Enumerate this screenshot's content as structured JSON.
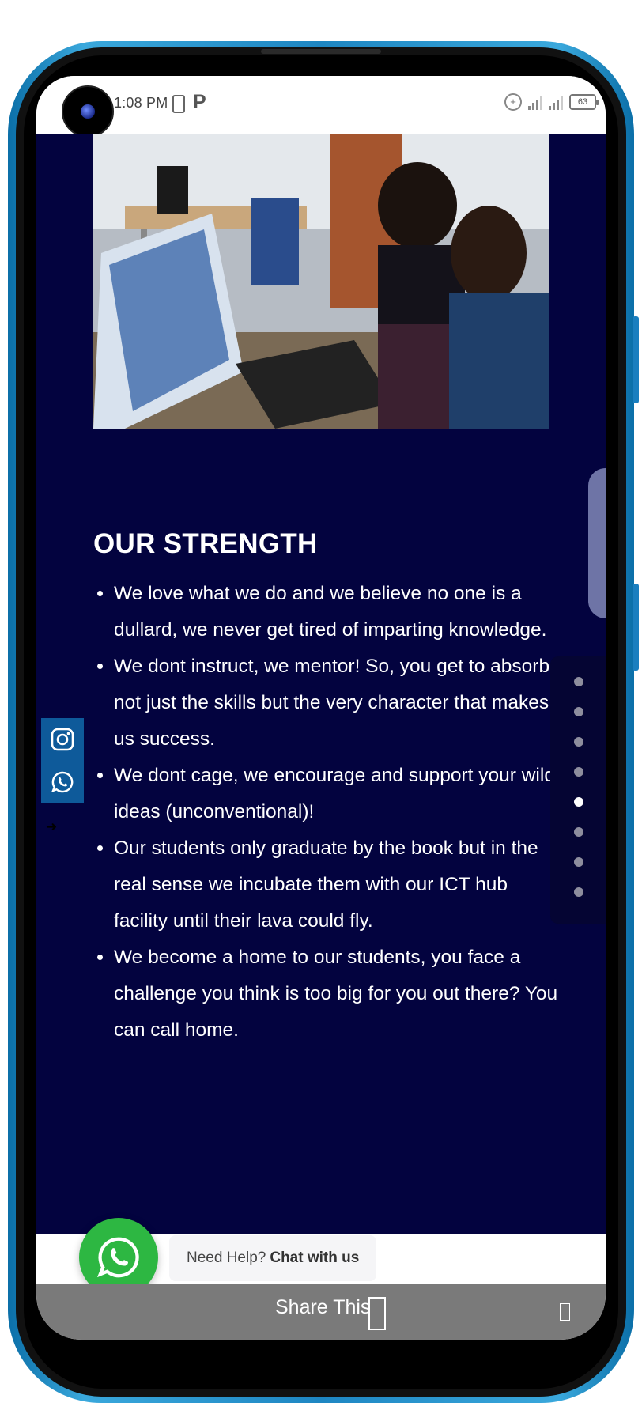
{
  "status_bar": {
    "time": "1:08 PM",
    "battery_level": "63",
    "icons": [
      "camera-icon",
      "battery-saver-icon",
      "p-app-icon",
      "data-saver-icon",
      "signal-icon",
      "signal-icon",
      "battery-icon"
    ]
  },
  "hero": {
    "image_alt": "hero-photo-team-at-laptop"
  },
  "strength": {
    "title": "OUR STRENGTH",
    "items": [
      "We love what we do and we believe no one is a dullard, we never get tired of imparting knowledge.",
      "We dont instruct, we mentor! So, you get to absorb not just the skills but the very character that makes us success.",
      "We dont cage, we encourage and support your wild ideas (unconventional)!",
      "Our students only graduate by the book but in the real sense we incubate them with our ICT hub facility until their lava could fly.",
      "We become a home to our students, you face a challenge you think is too big for you out there? You can call home."
    ]
  },
  "social": {
    "items": [
      "instagram-icon",
      "whatsapp-icon"
    ]
  },
  "dot_nav": {
    "count": 8,
    "active_index": 4
  },
  "chat": {
    "prefix": "Need Help?",
    "cta": "Chat with us"
  },
  "share": {
    "label": "Share This"
  },
  "colors": {
    "navy": "#03033f",
    "social_blue": "#0e5a9a",
    "whatsapp_green": "#2db742",
    "share_bar": "#7a7a7a",
    "phone_frame": "#1e86c2"
  }
}
